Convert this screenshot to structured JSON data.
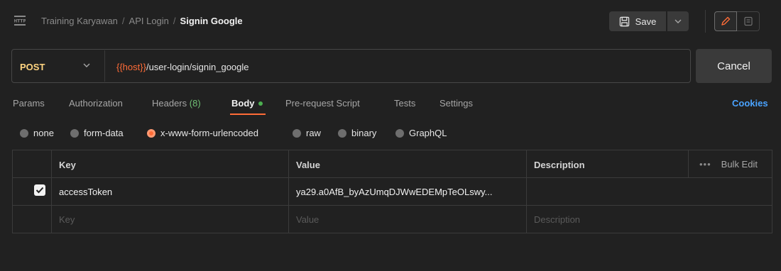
{
  "breadcrumb": {
    "items": [
      "Training Karyawan",
      "API Login"
    ],
    "current": "Signin Google",
    "separator": "/"
  },
  "toolbar": {
    "save_label": "Save"
  },
  "request": {
    "method": "POST",
    "url_variable": "{{host}}",
    "url_path": "/user-login/signin_google",
    "cancel_label": "Cancel"
  },
  "tabs": {
    "params": "Params",
    "authorization": "Authorization",
    "headers": "Headers",
    "headers_count": "(8)",
    "body": "Body",
    "prerequest": "Pre-request Script",
    "tests": "Tests",
    "settings": "Settings",
    "cookies": "Cookies"
  },
  "body_types": {
    "none": "none",
    "form_data": "form-data",
    "urlencoded": "x-www-form-urlencoded",
    "raw": "raw",
    "binary": "binary",
    "graphql": "GraphQL",
    "selected": "x-www-form-urlencoded"
  },
  "table": {
    "headers": {
      "key": "Key",
      "value": "Value",
      "description": "Description",
      "bulk_dots": "•••",
      "bulk_edit": "Bulk Edit"
    },
    "rows": [
      {
        "checked": true,
        "key": "accessToken",
        "value": "ya29.a0AfB_byAzUmqDJWwEDEMpTeOLswy...",
        "description": ""
      }
    ],
    "placeholder": {
      "key": "Key",
      "value": "Value",
      "description": "Description"
    }
  },
  "colors": {
    "accent": "#ff6c37",
    "method": "#ffd480",
    "link": "#4aa3ff",
    "status_dot": "#4caf50"
  },
  "icons": [
    "http-icon",
    "save-icon",
    "chevron-down-icon",
    "pencil-icon",
    "document-icon",
    "check-icon",
    "more-icon"
  ]
}
